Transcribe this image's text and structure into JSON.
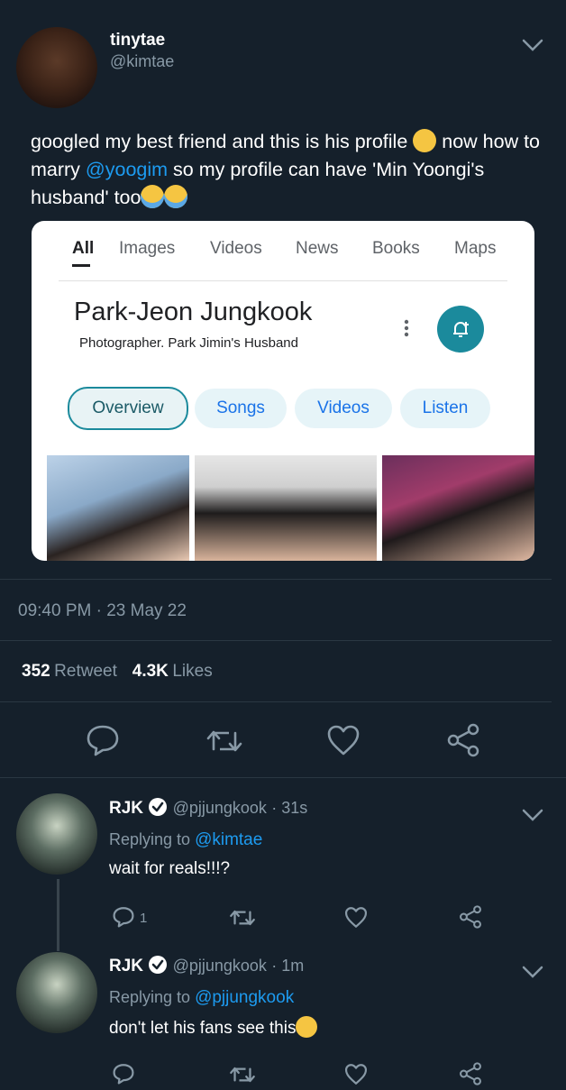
{
  "tweet": {
    "name": "tinytae",
    "handle": "@kimtae",
    "text_part1": "googled my best friend and this is his profile ",
    "text_part2": " now how to marry ",
    "mention": "@yoogim",
    "text_part3": " so my profile can have 'Min Yoongi's husband' too",
    "timestamp": "09:40 PM · 23 May 22",
    "retweet_count": "352",
    "retweet_label": "Retweet",
    "likes_count": "4.3K",
    "likes_label": "Likes"
  },
  "card": {
    "tabs": [
      "All",
      "Images",
      "Videos",
      "News",
      "Books",
      "Maps"
    ],
    "title": "Park-Jeon Jungkook",
    "subtitle": "Photographer. Park Jimin's Husband",
    "chips": [
      "Overview",
      "Songs",
      "Videos",
      "Listen"
    ]
  },
  "replies": [
    {
      "name": "RJK",
      "handle": "@pjjungkook",
      "time": "· 31s",
      "replying_label": "Replying to ",
      "replying_to": "@kimtae",
      "text": "wait for reals!!!?",
      "reply_count": "1"
    },
    {
      "name": "RJK",
      "handle": "@pjjungkook",
      "time": "· 1m",
      "replying_label": "Replying to ",
      "replying_to": "@pjjungkook",
      "text": "don't let his fans see this"
    }
  ],
  "colors": {
    "background": "#15202b",
    "accent": "#1d9bf0",
    "muted": "#8899a6"
  },
  "icons": [
    "chevron-down-icon",
    "reply-icon",
    "retweet-icon",
    "like-icon",
    "share-icon",
    "verified-icon",
    "notification-add-icon",
    "more-vert-icon"
  ]
}
